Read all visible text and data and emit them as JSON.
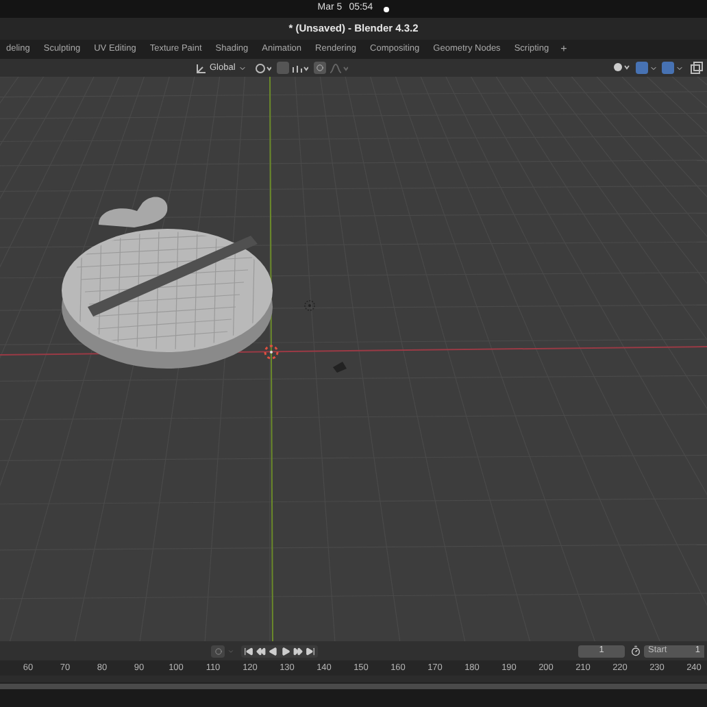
{
  "top_bar": {
    "date": "Mar 5",
    "time": "05:54"
  },
  "window": {
    "title": "* (Unsaved) - Blender 4.3.2"
  },
  "workspace_tabs": [
    {
      "label": "deling",
      "selected": false
    },
    {
      "label": "Sculpting",
      "selected": false
    },
    {
      "label": "UV Editing",
      "selected": false
    },
    {
      "label": "Texture Paint",
      "selected": false
    },
    {
      "label": "Shading",
      "selected": false
    },
    {
      "label": "Animation",
      "selected": false
    },
    {
      "label": "Rendering",
      "selected": false
    },
    {
      "label": "Compositing",
      "selected": false
    },
    {
      "label": "Geometry Nodes",
      "selected": false
    },
    {
      "label": "Scripting",
      "selected": false
    }
  ],
  "add_tab_button": "+",
  "viewport_header": {
    "orientation": "Global"
  },
  "timeline": {
    "current_frame": "1",
    "start_label": "Start",
    "start_frame": "1",
    "ruler": [
      "60",
      "70",
      "80",
      "90",
      "100",
      "110",
      "120",
      "130",
      "140",
      "150",
      "160",
      "170",
      "180",
      "190",
      "200",
      "210",
      "220",
      "230",
      "240"
    ]
  }
}
